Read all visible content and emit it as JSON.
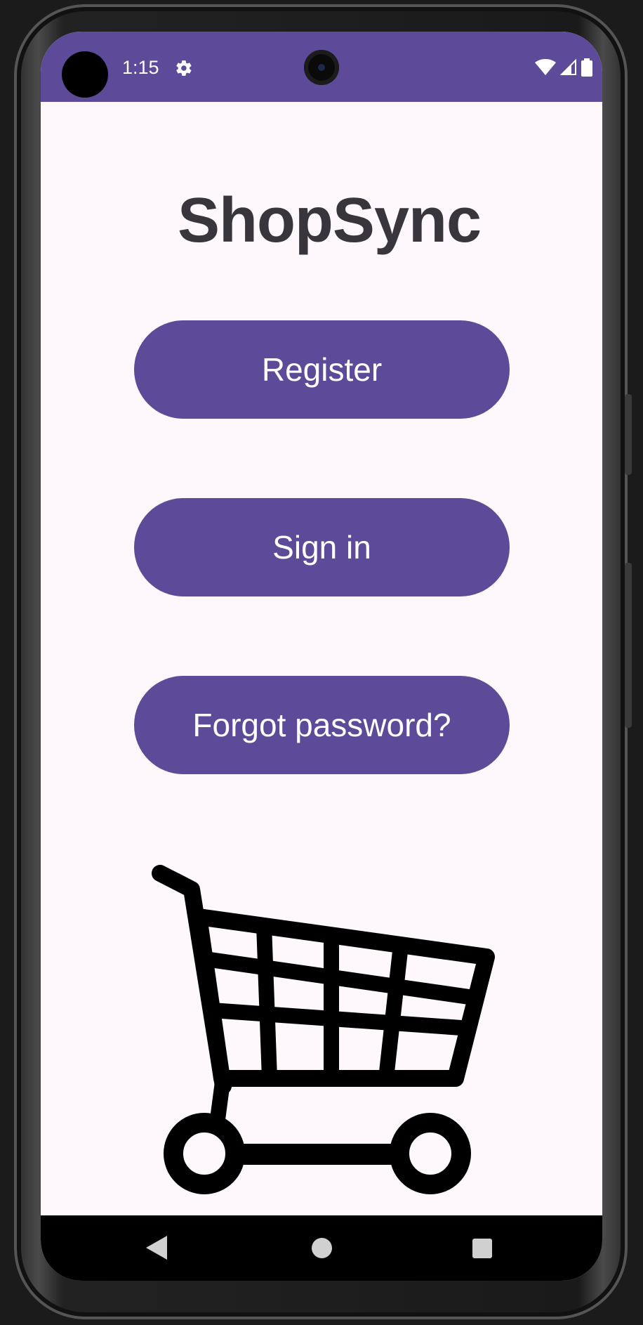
{
  "status_bar": {
    "time": "1:15",
    "icons": [
      "gear-icon",
      "wifi-icon",
      "cellular-signal-icon",
      "battery-icon"
    ],
    "background_color": "#5d4a98"
  },
  "app": {
    "title": "ShopSync",
    "title_color": "#38353d",
    "background_color": "#fef7fc"
  },
  "buttons": {
    "register_label": "Register",
    "sign_in_label": "Sign in",
    "forgot_password_label": "Forgot password?",
    "color": "#5d4a98",
    "text_color": "#ffffff"
  },
  "illustration": {
    "icon": "shopping-cart-icon"
  },
  "navigation": {
    "icons": [
      "back-icon",
      "home-icon",
      "recents-icon"
    ]
  }
}
